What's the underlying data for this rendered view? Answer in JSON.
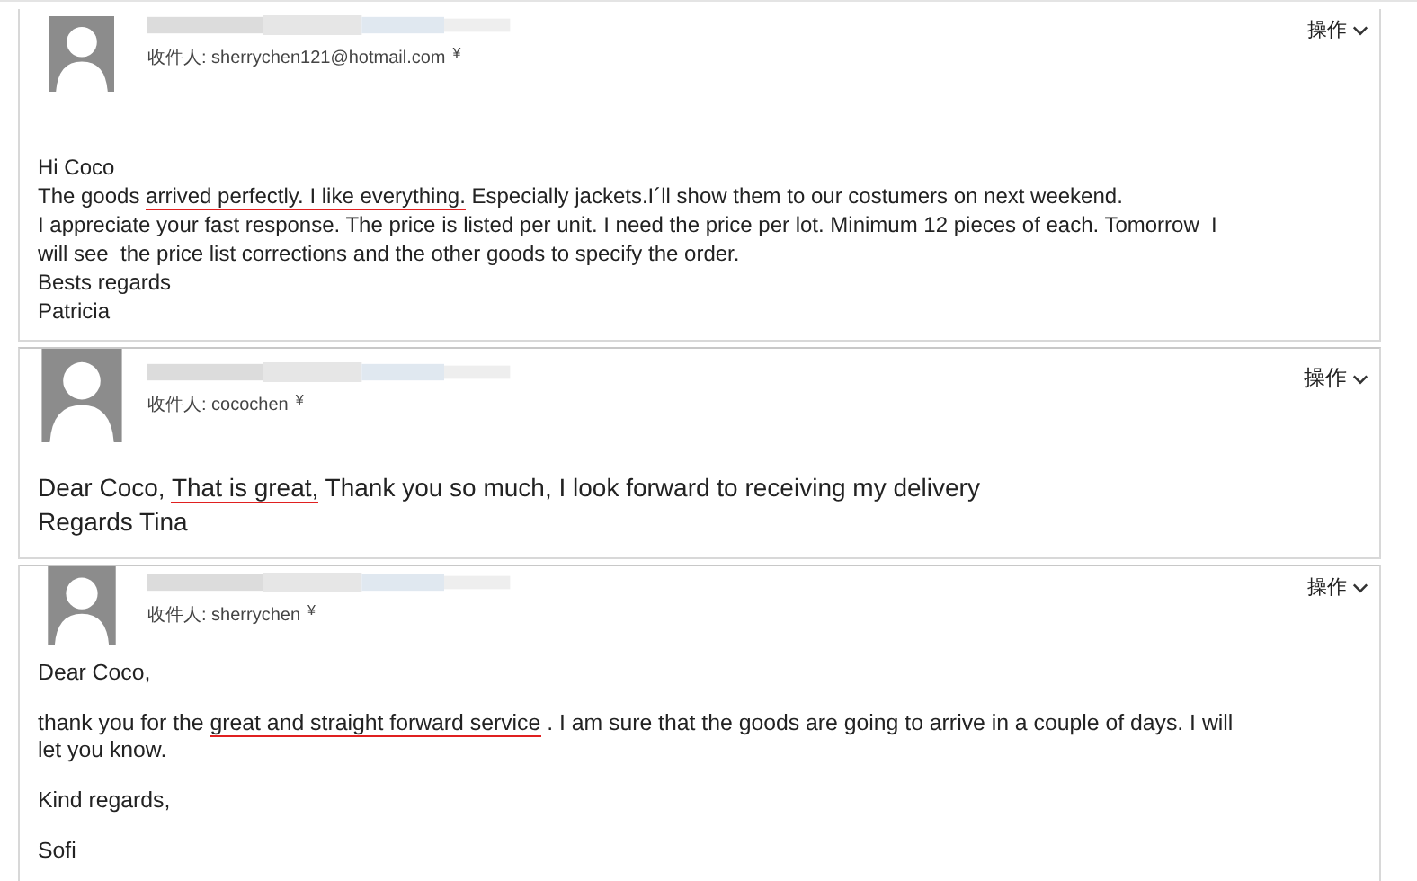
{
  "messages": [
    {
      "recipient_label": "收件人:",
      "recipient": "sherrychen121@hotmail.com",
      "expand": "¥",
      "actions": "操作",
      "paragraphs": [
        {
          "lines": [
            [
              {
                "text": "Hi Coco",
                "underlined": false
              }
            ],
            [
              {
                "text": "The goods ",
                "underlined": false
              },
              {
                "text": "arrived perfectly. I like everything.",
                "underlined": true
              },
              {
                "text": " Especially jackets.I´ll show them to our costumers on next weekend.",
                "underlined": false
              }
            ],
            [
              {
                "text": "I appreciate your fast response. The price is listed per unit. I need the price per lot. Minimum 12 pieces of each. Tomorrow  I",
                "underlined": false
              }
            ],
            [
              {
                "text": "will see  the price list corrections and the other goods to specify the order.",
                "underlined": false
              }
            ],
            [
              {
                "text": "Bests regards",
                "underlined": false
              }
            ],
            [
              {
                "text": "Patricia",
                "underlined": false
              }
            ]
          ]
        }
      ]
    },
    {
      "recipient_label": "收件人:",
      "recipient": "cocochen",
      "expand": "¥",
      "actions": "操作",
      "paragraphs": [
        {
          "lines": [
            [
              {
                "text": "Dear Coco, ",
                "underlined": false
              },
              {
                "text": "That is great,",
                "underlined": true
              },
              {
                "text": " Thank you so much, I look forward to receiving my delivery",
                "underlined": false
              }
            ],
            [
              {
                "text": "Regards Tina",
                "underlined": false
              }
            ]
          ]
        }
      ]
    },
    {
      "recipient_label": "收件人:",
      "recipient": "sherrychen",
      "expand": "¥",
      "actions": "操作",
      "paragraphs": [
        {
          "lines": [
            [
              {
                "text": "Dear Coco,",
                "underlined": false
              }
            ]
          ]
        },
        {
          "lines": [
            [
              {
                "text": "thank you for the ",
                "underlined": false
              },
              {
                "text": "great and straight forward service",
                "underlined": true
              },
              {
                "text": " . I am sure that the goods are going to arrive in a couple of days. I will",
                "underlined": false
              }
            ],
            [
              {
                "text": "let you know.",
                "underlined": false
              }
            ]
          ]
        },
        {
          "lines": [
            [
              {
                "text": "Kind regards,",
                "underlined": false
              }
            ]
          ]
        },
        {
          "lines": [
            [
              {
                "text": "Sofi",
                "underlined": false
              }
            ]
          ]
        }
      ]
    }
  ]
}
